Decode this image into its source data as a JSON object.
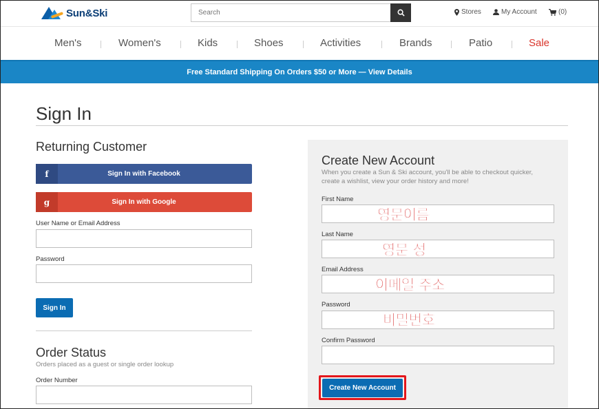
{
  "header": {
    "logo_text": "Sun&Ski",
    "search_placeholder": "Search",
    "stores": "Stores",
    "my_account": "My Account",
    "cart": "(0)"
  },
  "nav": [
    "Men's",
    "Women's",
    "Kids",
    "Shoes",
    "Activities",
    "Brands",
    "Patio",
    "Sale"
  ],
  "banner": "Free Standard Shipping On Orders $50 or More — View Details",
  "signin": {
    "title": "Sign In",
    "returning_heading": "Returning Customer",
    "facebook": "Sign In with Facebook",
    "facebook_icon": "f",
    "google": "Sign In with Google",
    "google_icon": "g",
    "username_label": "User Name or Email Address",
    "password_label": "Password",
    "signin_button": "Sign In"
  },
  "order_status": {
    "heading": "Order Status",
    "desc": "Orders placed as a guest or single order lookup",
    "order_number_label": "Order Number"
  },
  "create": {
    "heading": "Create New Account",
    "desc": "When you create a Sun & Ski account, you'll be able to checkout quicker, create a wishlist, view your order history and more!",
    "first_name_label": "First Name",
    "last_name_label": "Last Name",
    "email_label": "Email Address",
    "password_label": "Password",
    "confirm_label": "Confirm Password",
    "button": "Create New Account"
  },
  "annotations": {
    "first_name": "영문이름",
    "last_name": "영문 성",
    "email": "이메일 주소",
    "password": "비밀번호"
  },
  "colors": {
    "brand": "#0b3e76",
    "banner": "#1a86c6",
    "button": "#0b6cb3",
    "sale": "#d9342b",
    "annotation": "#d41c1c"
  }
}
